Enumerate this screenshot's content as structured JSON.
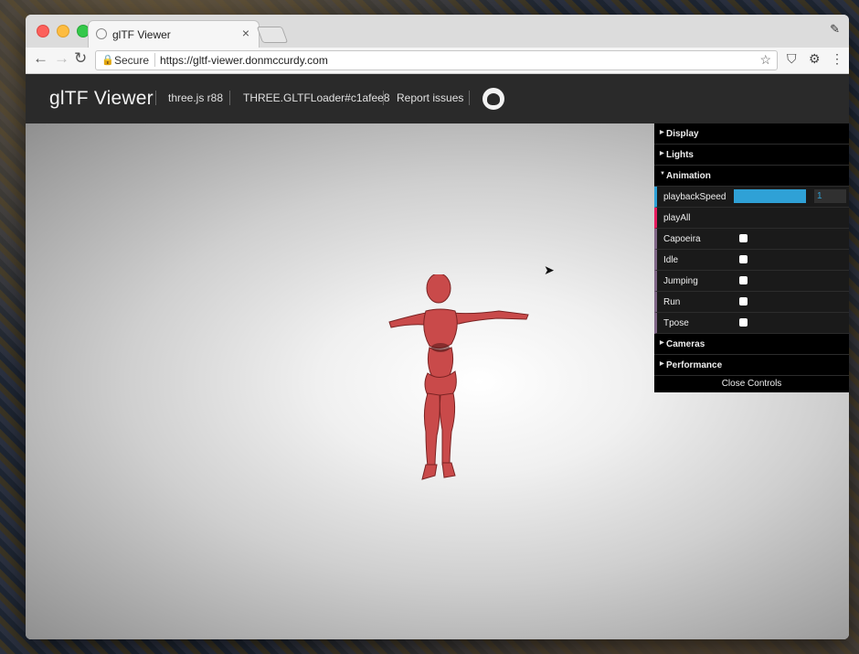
{
  "browser": {
    "tab_title": "glTF Viewer",
    "tab_close": "×",
    "secure_label": "Secure",
    "url": "https://gltf-viewer.donmccurdy.com",
    "lock_glyph": "🔒",
    "star_glyph": "☆",
    "back_glyph": "←",
    "forward_glyph": "→",
    "reload_glyph": "↻",
    "menu_glyph": "⋮",
    "profile_glyph": "✎"
  },
  "header": {
    "brand": "glTF Viewer",
    "links": [
      "three.js r88",
      "THREE.GLTFLoader#c1afee8",
      "Report issues"
    ],
    "github_icon": "github-icon"
  },
  "gui": {
    "folders": {
      "display": "Display",
      "lights": "Lights",
      "animation": "Animation",
      "cameras": "Cameras",
      "performance": "Performance"
    },
    "playback_speed": {
      "label": "playbackSpeed",
      "value": "1",
      "fraction": 1.0
    },
    "play_all": "playAll",
    "clips": [
      "Capoeira",
      "Idle",
      "Jumping",
      "Run",
      "Tpose"
    ],
    "close": "Close Controls"
  },
  "colors": {
    "header_bg": "#2a2a2a",
    "model": "#c94a4a",
    "slider": "#2fa1d6"
  }
}
